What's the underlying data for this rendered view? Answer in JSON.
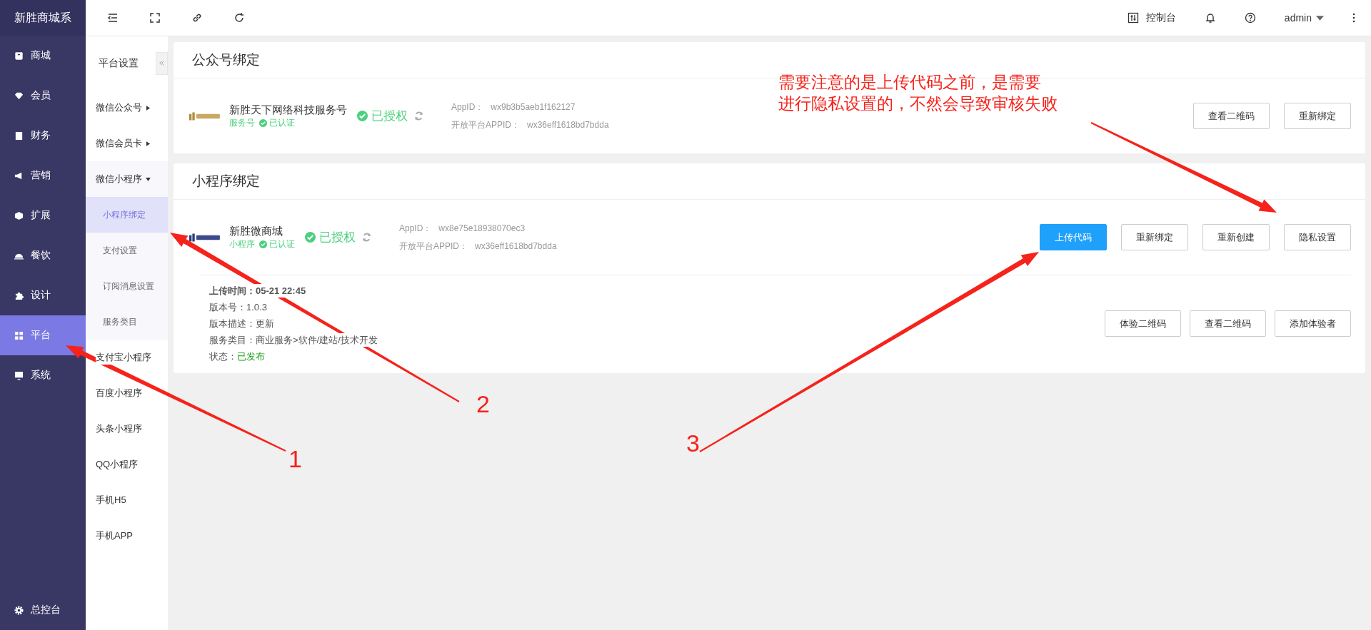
{
  "sidebar": {
    "brand": "新胜商城系",
    "items": [
      {
        "label": "商城",
        "selected": false
      },
      {
        "label": "会员",
        "selected": false
      },
      {
        "label": "财务",
        "selected": false
      },
      {
        "label": "营销",
        "selected": false
      },
      {
        "label": "扩展",
        "selected": false
      },
      {
        "label": "餐饮",
        "selected": false
      },
      {
        "label": "设计",
        "selected": false
      },
      {
        "label": "平台",
        "selected": true
      },
      {
        "label": "系统",
        "selected": false
      }
    ],
    "footer": "总控台"
  },
  "subnav": {
    "title": "平台设置",
    "items": [
      {
        "label": "微信公众号",
        "kind": "group",
        "expanded": false
      },
      {
        "label": "微信会员卡",
        "kind": "group",
        "expanded": false
      },
      {
        "label": "微信小程序",
        "kind": "group",
        "expanded": true,
        "children": [
          {
            "label": "小程序绑定",
            "selected": true
          },
          {
            "label": "支付设置",
            "selected": false
          },
          {
            "label": "订阅消息设置",
            "selected": false
          },
          {
            "label": "服务类目",
            "selected": false
          }
        ]
      },
      {
        "label": "支付宝小程序",
        "kind": "link"
      },
      {
        "label": "百度小程序",
        "kind": "link"
      },
      {
        "label": "头条小程序",
        "kind": "link"
      },
      {
        "label": "QQ小程序",
        "kind": "link"
      },
      {
        "label": "手机H5",
        "kind": "link"
      },
      {
        "label": "手机APP",
        "kind": "link"
      }
    ]
  },
  "topbar": {
    "console": "控制台",
    "user": "admin"
  },
  "cards": [
    {
      "title": "公众号绑定",
      "account": {
        "name": "新胜天下网络科技服务号",
        "type": "服务号",
        "verified": "已认证",
        "auth": "已授权",
        "appid_label": "AppID：",
        "appid": "wx9b3b5aeb1f162127",
        "open_label": "开放平台APPID：",
        "open_appid": "wx36eff1618bd7bdda"
      },
      "buttons": [
        {
          "label": "查看二维码",
          "primary": false
        },
        {
          "label": "重新绑定",
          "primary": false
        }
      ]
    },
    {
      "title": "小程序绑定",
      "account": {
        "name": "新胜微商城",
        "type": "小程序",
        "verified": "已认证",
        "auth": "已授权",
        "appid_label": "AppID：",
        "appid": "wx8e75e18938070ec3",
        "open_label": "开放平台APPID：",
        "open_appid": "wx36eff1618bd7bdda"
      },
      "buttons": [
        {
          "label": "上传代码",
          "primary": true
        },
        {
          "label": "重新绑定",
          "primary": false
        },
        {
          "label": "重新创建",
          "primary": false
        },
        {
          "label": "隐私设置",
          "primary": false
        }
      ],
      "details": [
        {
          "label": "上传时间：",
          "value": "05-21 22:45",
          "kind": "bold"
        },
        {
          "label": "版本号：",
          "value": "1.0.3",
          "kind": "plain"
        },
        {
          "label": "版本描述：",
          "value": "更新",
          "kind": "plain"
        },
        {
          "label": "服务类目：",
          "value": "商业服务>软件/建站/技术开发",
          "kind": "plain"
        },
        {
          "label": "状态：",
          "value": "已发布",
          "kind": "status"
        }
      ],
      "detail_buttons": [
        {
          "label": "体验二维码",
          "primary": false
        },
        {
          "label": "查看二维码",
          "primary": false
        },
        {
          "label": "添加体验者",
          "primary": false
        }
      ]
    }
  ],
  "annotations": {
    "note": [
      "需要注意的是上传代码之前，是需要",
      "进行隐私设置的，不然会导致审核失败"
    ],
    "markers": [
      "1",
      "2",
      "3"
    ]
  }
}
